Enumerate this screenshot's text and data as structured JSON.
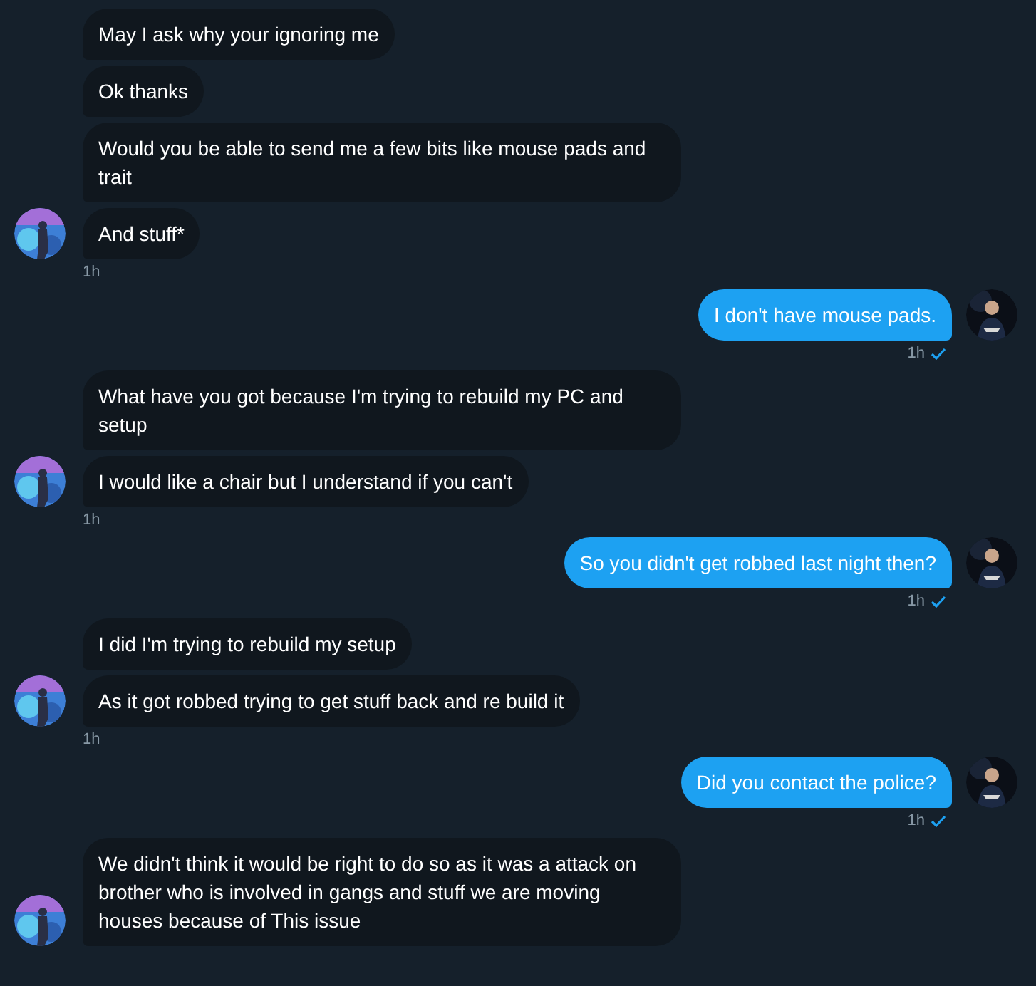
{
  "conversation": [
    {
      "kind": "received",
      "messages": [
        "May I ask why your ignoring me",
        "Ok thanks",
        "Would you be able to send me a few bits like mouse pads and trait",
        "And stuff*"
      ],
      "time": "1h"
    },
    {
      "kind": "sent",
      "messages": [
        "I don't have mouse pads."
      ],
      "time": "1h",
      "seen": true
    },
    {
      "kind": "received",
      "messages": [
        "What have you got because I'm trying to rebuild my PC and setup",
        "I would like a chair but I understand if you can't"
      ],
      "time": "1h"
    },
    {
      "kind": "sent",
      "messages": [
        "So you didn't get robbed last night then?"
      ],
      "time": "1h",
      "seen": true
    },
    {
      "kind": "received",
      "messages": [
        "I did I'm trying to rebuild my setup",
        "As it got robbed trying to get stuff back and re build it"
      ],
      "time": "1h"
    },
    {
      "kind": "sent",
      "messages": [
        "Did you contact the police?"
      ],
      "time": "1h",
      "seen": true
    },
    {
      "kind": "received",
      "messages": [
        "We didn't think it would be right to do so as it was a attack on brother who is involved in gangs and stuff we are moving houses because of  This issue"
      ]
    }
  ]
}
